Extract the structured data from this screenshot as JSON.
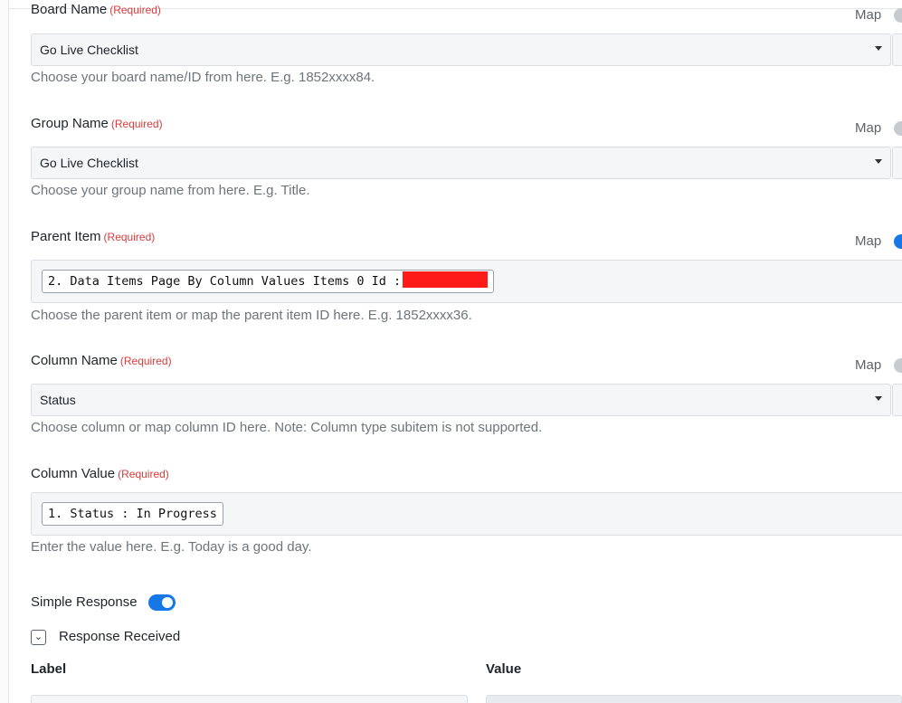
{
  "fields": {
    "board_name": {
      "label": "Board Name",
      "required": "(Required)",
      "map_label": "Map",
      "value": "Go Live Checklist",
      "help": "Choose your board name/ID from here. E.g. 1852xxxx84."
    },
    "group_name": {
      "label": "Group Name",
      "required": "(Required)",
      "map_label": "Map",
      "value": "Go Live Checklist",
      "help": "Choose your group name from here. E.g. Title."
    },
    "parent_item": {
      "label": "Parent Item",
      "required": "(Required)",
      "map_label": "Map",
      "mapped_value": "2. Data Items Page By Column Values Items 0 Id :",
      "help": "Choose the parent item or map the parent item ID here. E.g. 1852xxxx36."
    },
    "column_name": {
      "label": "Column Name",
      "required": "(Required)",
      "map_label": "Map",
      "value": "Status",
      "help": "Choose column or map column ID here. Note: Column type subitem is not supported."
    },
    "column_value": {
      "label": "Column Value",
      "required": "(Required)",
      "mapped_value": "1. Status : In Progress",
      "help": "Enter the value here. E.g. Today is a good day."
    }
  },
  "simple_response": {
    "label": "Simple Response",
    "enabled": true
  },
  "response_received": {
    "label": "Response Received",
    "expanded": true
  },
  "table": {
    "headers": [
      "Label",
      "Value"
    ]
  },
  "colors": {
    "accent": "#1677e6",
    "required": "#d93a3a",
    "redaction": "#ff1a1a"
  }
}
